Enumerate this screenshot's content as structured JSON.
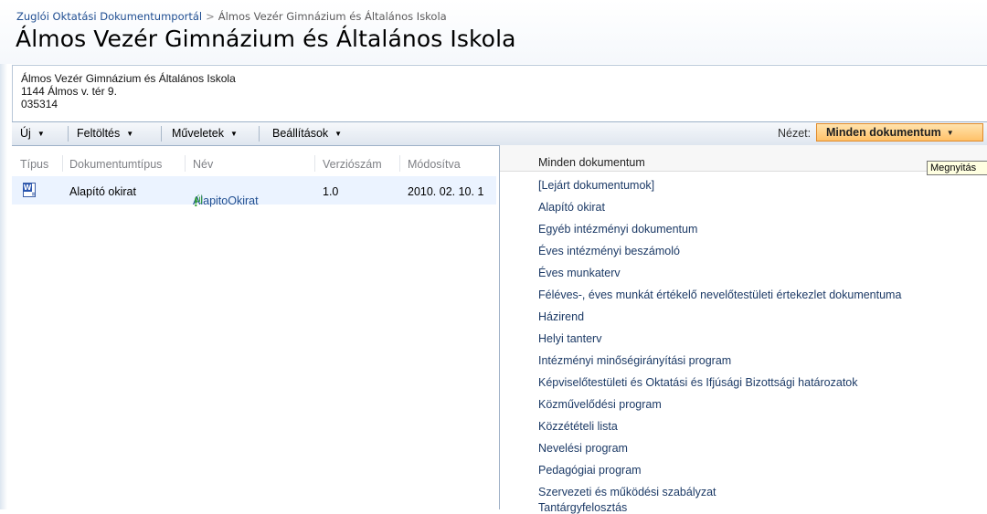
{
  "header": {
    "breadcrumb_portal": "Zuglói Oktatási Dokumentumportál",
    "breadcrumb_separator": ">",
    "breadcrumb_current": "Álmos Vezér Gimnázium és Általános Iskola",
    "title": "Álmos Vezér Gimnázium és Általános Iskola"
  },
  "description": {
    "line1": "Álmos Vezér Gimnázium és Általános Iskola",
    "line2": "1144 Álmos v. tér 9.",
    "line3": "035314"
  },
  "toolbar": {
    "new_label": "Új",
    "upload_label": "Feltöltés",
    "actions_label": "Műveletek",
    "settings_label": "Beállítások",
    "view_label": "Nézet:",
    "view_value": "Minden dokumentum"
  },
  "grid": {
    "columns": [
      "Típus",
      "Dokumentumtípus",
      "Név",
      "Verziószám",
      "Módosítva"
    ],
    "rows": [
      {
        "icon": "word-document-icon",
        "doc_type": "Alapító okirat",
        "name": "AlapitoOkirat",
        "new_badge": "új",
        "new_mark": "!",
        "version": "1.0",
        "modified": "2010. 02. 10. 1"
      }
    ]
  },
  "view_menu": {
    "items": [
      "Minden dokumentum",
      "[Lejárt dokumentumok]",
      "Alapító okirat",
      "Egyéb intézményi dokumentum",
      "Éves intézményi beszámoló",
      "Éves munkaterv",
      "Féléves-, éves munkát értékelő nevelőtestületi értekezlet dokumentuma",
      "Házirend",
      "Helyi tanterv",
      "Intézményi minőségirányítási program",
      "Képviselőtestületi és Oktatási és Ifjúsági Bizottsági határozatok",
      "Közművelődési program",
      "Közzétételi lista",
      "Nevelési program",
      "Pedagógiai program",
      "Szervezeti és működési szabályzat",
      "Tantárgyfelosztás"
    ]
  },
  "tooltip": "Megnyitás"
}
